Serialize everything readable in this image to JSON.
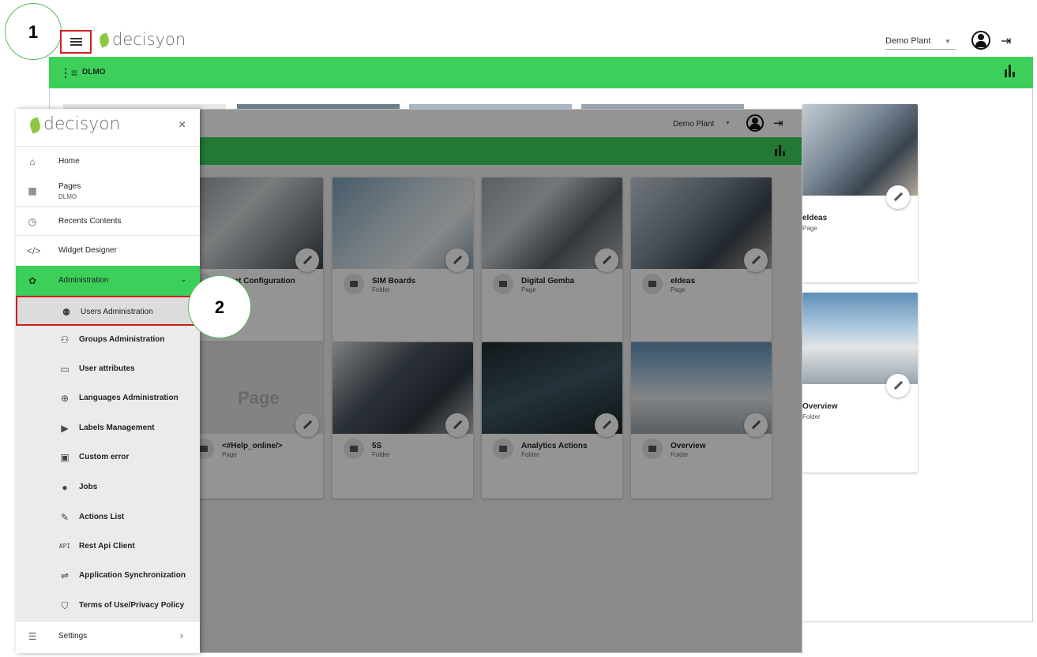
{
  "outer": {
    "plant": "Demo Plant",
    "breadcrumb": "DLMO",
    "colors": {
      "green_bar": "#3ccf5a",
      "leaf": "#8dc63f",
      "highlight": "#cc1f1f"
    },
    "right_cards": [
      {
        "title": "eIdeas",
        "sub": "Page"
      },
      {
        "title": "Overview",
        "sub": "Folder"
      }
    ]
  },
  "inner": {
    "plant": "Demo Plant",
    "cards": [
      {
        "title": "Plant Configuration",
        "sub": "",
        "type": "page"
      },
      {
        "title": "SIM Boards",
        "sub": "Folder",
        "type": "folder"
      },
      {
        "title": "Digital Gemba",
        "sub": "Page",
        "type": "page"
      },
      {
        "title": "eIdeas",
        "sub": "Page",
        "type": "page"
      },
      {
        "title": "<#Help_online/>",
        "sub": "Page",
        "type": "page"
      },
      {
        "title": "5S",
        "sub": "Folder",
        "type": "folder"
      },
      {
        "title": "Analytics Actions",
        "sub": "Folder",
        "type": "folder"
      },
      {
        "title": "Overview",
        "sub": "Folder",
        "type": "folder"
      }
    ],
    "page_placeholder": "Page"
  },
  "drawer": {
    "logo": "decisyon",
    "items": {
      "home": "Home",
      "pages": "Pages",
      "pages_sub": "DLMO",
      "recents": "Recents Contents",
      "widget": "Widget Designer",
      "admin": "Administration",
      "settings": "Settings"
    },
    "admin_items": [
      {
        "label": "Users Administration",
        "icon": "users-gear-icon"
      },
      {
        "label": "Groups Administration",
        "icon": "groups-icon"
      },
      {
        "label": "User attributes",
        "icon": "user-attributes-icon"
      },
      {
        "label": "Languages Administration",
        "icon": "globe-icon"
      },
      {
        "label": "Labels Management",
        "icon": "label-icon"
      },
      {
        "label": "Custom error",
        "icon": "error-icon"
      },
      {
        "label": "Jobs",
        "icon": "jobs-icon"
      },
      {
        "label": "Actions List",
        "icon": "wrench-icon"
      },
      {
        "label": "Rest Api Client",
        "icon": "api-icon"
      },
      {
        "label": "Application Synchronization",
        "icon": "sync-icon"
      },
      {
        "label": "Terms of Use/Privacy Policy",
        "icon": "shield-icon"
      }
    ],
    "api_glyph": "API"
  },
  "callouts": {
    "one": "1",
    "two": "2"
  },
  "logo": "decisyon"
}
